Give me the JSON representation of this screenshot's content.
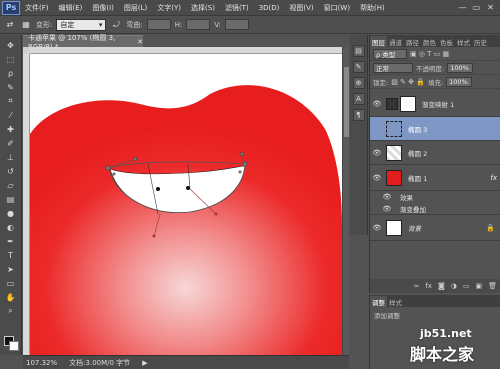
{
  "app": {
    "logo": "Ps"
  },
  "menu": [
    "文件(F)",
    "编辑(E)",
    "图像(I)",
    "图层(L)",
    "文字(Y)",
    "选择(S)",
    "滤镜(T)",
    "3D(D)",
    "视图(V)",
    "窗口(W)",
    "帮助(H)"
  ],
  "window_controls": {
    "minimize": "—",
    "restore": "▭",
    "close": "✕"
  },
  "options": {
    "transform_label": "变形:",
    "preset_value": "自定",
    "bend_label": "弯曲:",
    "h_label": "H:",
    "v_label": "V:"
  },
  "document": {
    "tab_title": "卡通苹果 @ 107% (椭圆 3, RGB/8) *",
    "close_icon": "✕",
    "zoom": "107.32%",
    "doc_info": "文档:3.00M/0 字节"
  },
  "layers_panel": {
    "tabs": [
      "图层",
      "通道",
      "路径",
      "颜色",
      "色板",
      "样式",
      "历史"
    ],
    "kind_label": "ρ 类型",
    "blend_mode": "正常",
    "opacity_label": "不透明度:",
    "opacity_value": "100%",
    "lock_label": "锁定:",
    "fill_label": "填充:",
    "fill_value": "100%",
    "layers": [
      {
        "name": "渐变映射 1",
        "visible": true,
        "selected": false
      },
      {
        "name": "椭圆 3",
        "visible": false,
        "selected": true
      },
      {
        "name": "椭圆 2",
        "visible": true,
        "selected": false
      },
      {
        "name": "椭圆 1",
        "visible": true,
        "selected": false,
        "fx": "fx"
      },
      {
        "name": "效果",
        "visible": true,
        "sub": true
      },
      {
        "name": "渐变叠加",
        "visible": true,
        "sub": true
      },
      {
        "name": "背景",
        "visible": true,
        "selected": false,
        "italic": true
      }
    ]
  },
  "adjust_panel": {
    "tabs": [
      "调整",
      "样式"
    ],
    "add_label": "添加调整"
  },
  "watermark": {
    "url": "jb51.net",
    "text": "脚本之家"
  },
  "colors": {
    "red": "#ee2222",
    "selected_layer": "#7f97c5"
  }
}
